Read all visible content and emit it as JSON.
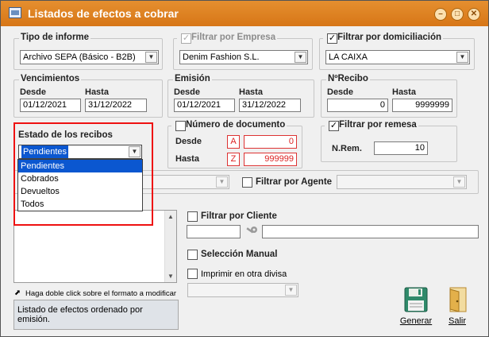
{
  "window": {
    "title": "Listados de efectos a cobrar",
    "buttons": {
      "minimize": "–",
      "maximize": "□",
      "close": "✕"
    }
  },
  "tipo_informe": {
    "legend": "Tipo de informe",
    "value": "Archivo SEPA (Básico - B2B)"
  },
  "empresa": {
    "legend": "Filtrar por Empresa",
    "checked": true,
    "enabled": false,
    "value": "Denim Fashion S.L."
  },
  "domiciliacion": {
    "legend": "Filtrar por domiciliación",
    "checked": true,
    "value": "LA CAIXA"
  },
  "vencimientos": {
    "legend": "Vencimientos",
    "desde_label": "Desde",
    "hasta_label": "Hasta",
    "desde": "01/12/2021",
    "hasta": "31/12/2022"
  },
  "emision": {
    "legend": "Emisión",
    "desde_label": "Desde",
    "hasta_label": "Hasta",
    "desde": "01/12/2021",
    "hasta": "31/12/2022"
  },
  "nrecibo": {
    "legend": "NºRecibo",
    "desde_label": "Desde",
    "hasta_label": "Hasta",
    "desde": "0",
    "hasta": "9999999"
  },
  "estado": {
    "legend": "Estado de los recibos",
    "value": "Pendientes",
    "options": [
      "Pendientes",
      "Cobrados",
      "Devueltos",
      "Todos"
    ],
    "selected_index": 0
  },
  "num_documento": {
    "label": "Número de documento",
    "checked": false,
    "desde_label": "Desde",
    "hasta_label": "Hasta",
    "desde_prefix": "A",
    "hasta_prefix": "Z",
    "desde": "0",
    "hasta": "999999"
  },
  "remesa": {
    "legend": "Filtrar por remesa",
    "checked": true,
    "label": "N.Rem.",
    "value": "10"
  },
  "agente": {
    "label": "Filtrar por Agente",
    "checked": false
  },
  "cliente": {
    "label": "Filtrar por Cliente",
    "checked": false
  },
  "seleccion_manual": {
    "label": "Selección Manual",
    "checked": false
  },
  "otra_divisa": {
    "label": "Imprimir en otra divisa",
    "checked": false
  },
  "formato": {
    "hint": "Haga doble click sobre el formato a modificar",
    "description": "Listado de efectos ordenado por emisión."
  },
  "actions": {
    "generar": "Generar",
    "salir": "Salir"
  },
  "colors": {
    "titlebar": "#d97b1b",
    "highlight": "#e11111",
    "selection": "#0b57d0"
  }
}
